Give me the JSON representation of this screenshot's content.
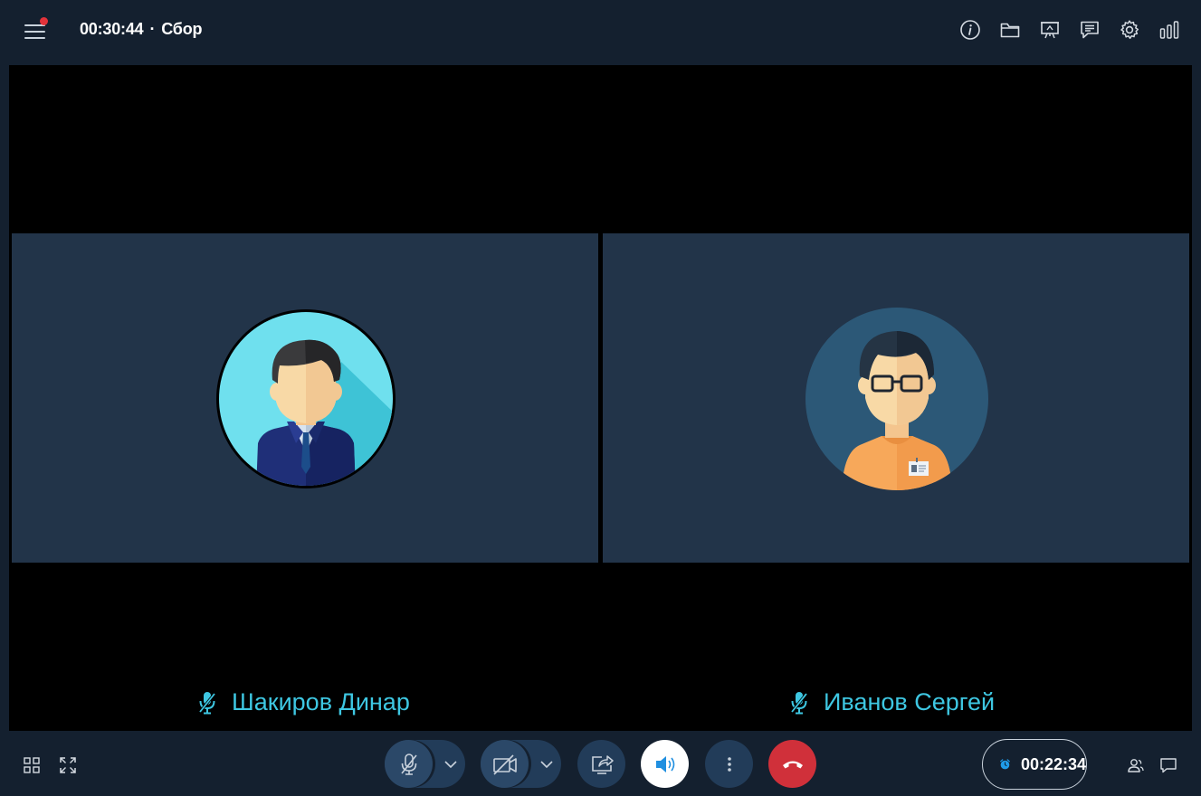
{
  "header": {
    "elapsed_time": "00:30:44",
    "separator": "·",
    "meeting_title": "Сбор"
  },
  "participants": [
    {
      "name": "Шакиров Динар"
    },
    {
      "name": "Иванов Сергей"
    }
  ],
  "footer": {
    "timer": "00:22:34"
  },
  "colors": {
    "background": "#14202f",
    "stage": "#000000",
    "tile": "#223449",
    "name": "#3ec7e2",
    "control": "#223c59",
    "hangup": "#d0303a",
    "notification_dot": "#e3323a"
  }
}
